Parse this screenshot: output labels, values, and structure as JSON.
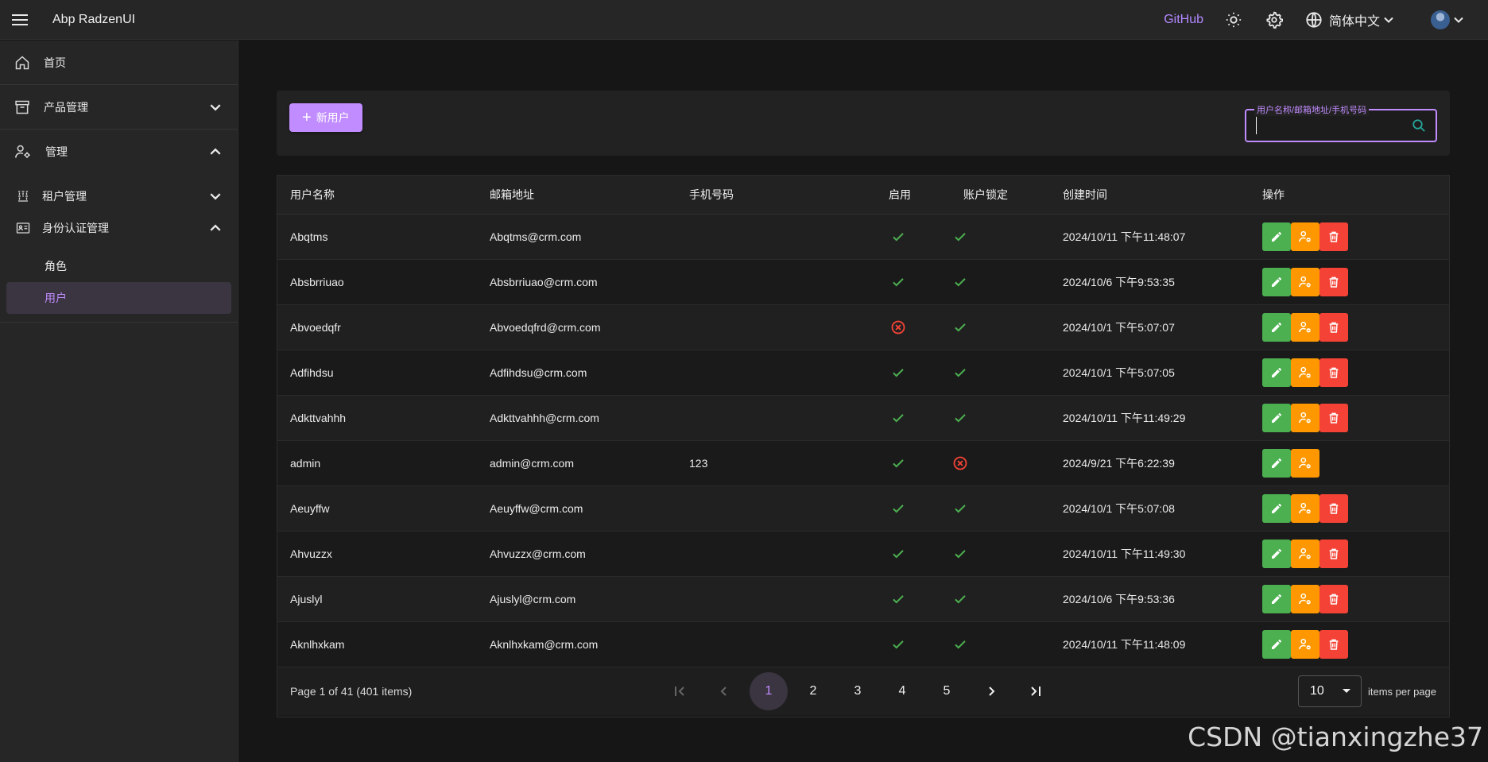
{
  "app": {
    "title": "Abp RadzenUI"
  },
  "header": {
    "github_label": "GitHub",
    "language_label": "简体中文",
    "icons": [
      "menu-icon",
      "sun-icon",
      "gear-icon",
      "globe-icon",
      "chevron-down-icon",
      "avatar"
    ]
  },
  "sidebar": {
    "home": "首页",
    "product": "产品管理",
    "admin": "管理",
    "tenant": "租户管理",
    "identity": "身份认证管理",
    "roles": "角色",
    "users": "用户"
  },
  "toolbar": {
    "new_user_label": "新用户",
    "search_label": "用户名称/邮箱地址/手机号码",
    "search_value": ""
  },
  "table": {
    "columns": [
      "用户名称",
      "邮箱地址",
      "手机号码",
      "启用",
      "账户锁定",
      "创建时间",
      "操作"
    ],
    "rows": [
      {
        "name": "Abqtms",
        "email": "Abqtms@crm.com",
        "phone": "",
        "enabled": true,
        "locked_ok": true,
        "created": "2024/10/11 下午11:48:07",
        "deletable": true
      },
      {
        "name": "Absbrriuao",
        "email": "Absbrriuao@crm.com",
        "phone": "",
        "enabled": true,
        "locked_ok": true,
        "created": "2024/10/6 下午9:53:35",
        "deletable": true
      },
      {
        "name": "Abvoedqfr",
        "email": "Abvoedqfrd@crm.com",
        "phone": "",
        "enabled": false,
        "locked_ok": true,
        "created": "2024/10/1 下午5:07:07",
        "deletable": true
      },
      {
        "name": "Adfihdsu",
        "email": "Adfihdsu@crm.com",
        "phone": "",
        "enabled": true,
        "locked_ok": true,
        "created": "2024/10/1 下午5:07:05",
        "deletable": true
      },
      {
        "name": "Adkttvahhh",
        "email": "Adkttvahhh@crm.com",
        "phone": "",
        "enabled": true,
        "locked_ok": true,
        "created": "2024/10/11 下午11:49:29",
        "deletable": true
      },
      {
        "name": "admin",
        "email": "admin@crm.com",
        "phone": "123",
        "enabled": true,
        "locked_ok": false,
        "created": "2024/9/21 下午6:22:39",
        "deletable": false
      },
      {
        "name": "Aeuyffw",
        "email": "Aeuyffw@crm.com",
        "phone": "",
        "enabled": true,
        "locked_ok": true,
        "created": "2024/10/1 下午5:07:08",
        "deletable": true
      },
      {
        "name": "Ahvuzzx",
        "email": "Ahvuzzx@crm.com",
        "phone": "",
        "enabled": true,
        "locked_ok": true,
        "created": "2024/10/11 下午11:49:30",
        "deletable": true
      },
      {
        "name": "Ajuslyl",
        "email": "Ajuslyl@crm.com",
        "phone": "",
        "enabled": true,
        "locked_ok": true,
        "created": "2024/10/6 下午9:53:36",
        "deletable": true
      },
      {
        "name": "Aknlhxkam",
        "email": "Aknlhxkam@crm.com",
        "phone": "",
        "enabled": true,
        "locked_ok": true,
        "created": "2024/10/11 下午11:48:09",
        "deletable": true
      }
    ]
  },
  "pager": {
    "summary": "Page 1 of 41 (401 items)",
    "pages": [
      "1",
      "2",
      "3",
      "4",
      "5"
    ],
    "current": "1",
    "page_size": "10",
    "items_per_page_label": "items per page"
  },
  "watermark": "CSDN @tianxingzhe37",
  "colors": {
    "accent": "#c18cff",
    "edit": "#4caf50",
    "role": "#ff9800",
    "delete": "#f44336",
    "check": "#4caf50",
    "cross": "#f44336"
  }
}
